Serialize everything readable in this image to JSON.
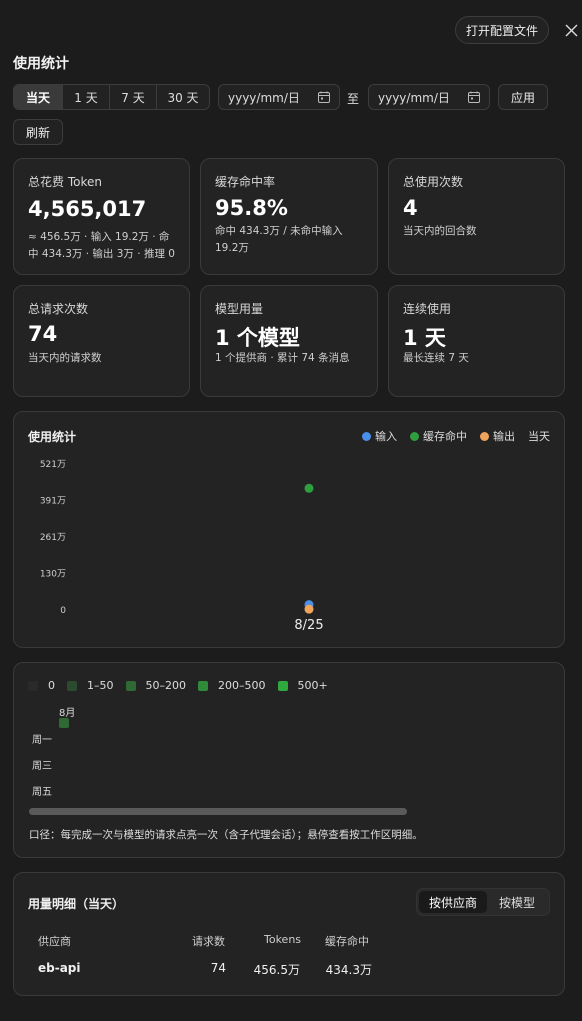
{
  "header": {
    "open_config_label": "打开配置文件",
    "section_title": "使用统计"
  },
  "filters": {
    "ranges": [
      "当天",
      "1 天",
      "7 天",
      "30 天"
    ],
    "active_range": "当天",
    "date_from_placeholder": "yyyy/mm/日",
    "to_label": "至",
    "date_to_placeholder": "yyyy/mm/日",
    "apply_label": "应用",
    "refresh_label": "刷新"
  },
  "stats": {
    "total_cost": {
      "label": "总花费 Token",
      "value": "4,565,017",
      "sub": "≈ 456.5万 · 输入 19.2万 · 命中 434.3万 · 输出 3万 · 推理 0"
    },
    "cache_hit": {
      "label": "缓存命中率",
      "value": "95.8%",
      "sub": "命中 434.3万 / 未命中输入 19.2万"
    },
    "total_uses": {
      "label": "总使用次数",
      "value": "4",
      "sub": "当天内的回合数"
    },
    "total_requests": {
      "label": "总请求次数",
      "value": "74",
      "sub": "当天内的请求数"
    },
    "model_usage": {
      "label": "模型用量",
      "value": "1 个模型",
      "sub": "1 个提供商 · 累计 74 条消息"
    },
    "streak": {
      "label": "连续使用",
      "value": "1 天",
      "sub": "最长连续 7 天"
    }
  },
  "usage_chart": {
    "title": "使用统计",
    "legend": [
      "输入",
      "缓存命中",
      "输出"
    ],
    "period_label": "当天",
    "colors": {
      "input": "#4a8fe8",
      "cache": "#2e9e3e",
      "output": "#f0a35a"
    }
  },
  "chart_data": {
    "type": "scatter",
    "categories": [
      "8/25"
    ],
    "series": [
      {
        "name": "输入",
        "values": [
          192000
        ]
      },
      {
        "name": "缓存命中",
        "values": [
          4343000
        ]
      },
      {
        "name": "输出",
        "values": [
          30000
        ]
      }
    ],
    "yticks": [
      "521万",
      "391万",
      "261万",
      "130万",
      "0"
    ],
    "ytick_values": [
      5210000,
      3910000,
      2610000,
      1300000,
      0
    ],
    "ylim": [
      0,
      5210000
    ],
    "grid": false,
    "legend_position": "top-right"
  },
  "heatmap": {
    "legend": [
      "0",
      "1–50",
      "50–200",
      "200–500",
      "500+"
    ],
    "legend_colors": [
      "#2a2a2a",
      "#2b4a2e",
      "#2f6a35",
      "#2f8a3a",
      "#2fa83d"
    ],
    "month_label": "8月",
    "weekday_labels": [
      "周一",
      "周三",
      "周五"
    ],
    "active_cell_level": 1,
    "note": "口径：每完成一次与模型的请求点亮一次（含子代理会话）；悬停查看按工作区明细。"
  },
  "detail": {
    "title": "用量明细（当天）",
    "toggles": [
      "按供应商",
      "按模型"
    ],
    "active_toggle": "按供应商",
    "columns": [
      "供应商",
      "请求数",
      "Tokens",
      "缓存命中"
    ],
    "rows": [
      {
        "provider": "eb-api",
        "requests": "74",
        "tokens": "456.5万",
        "cache_hit": "434.3万"
      }
    ]
  }
}
